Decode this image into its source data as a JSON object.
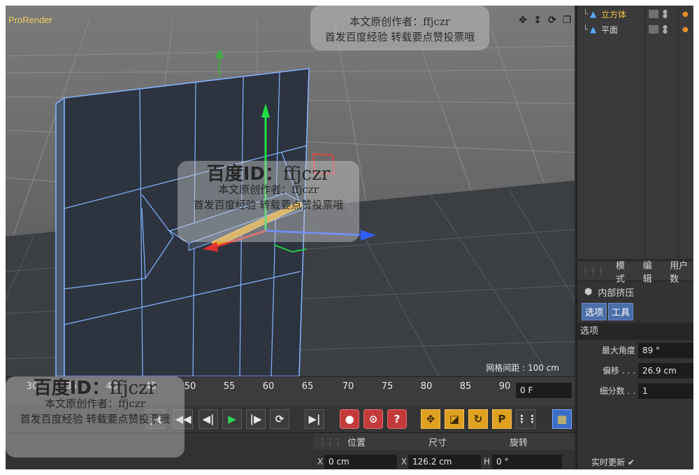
{
  "viewport": {
    "renderer_label": "ProRender",
    "grid_spacing": "网格间距 : 100 cm",
    "nav_icons": [
      "move-view-icon",
      "zoom-view-icon",
      "rotate-view-icon",
      "maximize-view-icon"
    ]
  },
  "objects": [
    {
      "name": "立方体",
      "icon": "cube-object-icon",
      "color": "#f0c040"
    },
    {
      "name": "平面",
      "icon": "plane-object-icon",
      "color": "#e0e0e0"
    }
  ],
  "attributes": {
    "menu": [
      "模式",
      "编辑",
      "用户数"
    ],
    "tool_name": "内部挤压",
    "tabs": [
      "选项",
      "工具"
    ],
    "section": "选项",
    "fields": [
      {
        "label": "最大角度",
        "value": "89 °"
      },
      {
        "label": "偏移 . . .",
        "value": "26.9 cm"
      },
      {
        "label": "细分数 . .",
        "value": "1"
      }
    ],
    "realtime_update": "实时更新 ✔"
  },
  "timeline": {
    "ticks": [
      "30",
      "35",
      "40",
      "45",
      "50",
      "55",
      "60",
      "65",
      "70",
      "75",
      "80",
      "85",
      "90"
    ],
    "current_frame": "0 F"
  },
  "transport": {
    "buttons": [
      {
        "name": "goto-start-button",
        "glyph": "|◀"
      },
      {
        "name": "prev-key-button",
        "glyph": "◀◀"
      },
      {
        "name": "prev-frame-button",
        "glyph": "◀|"
      },
      {
        "name": "play-button",
        "glyph": "▶"
      },
      {
        "name": "next-frame-button",
        "glyph": "|▶"
      },
      {
        "name": "loop-button",
        "glyph": "⟳"
      },
      {
        "name": "goto-end-button",
        "glyph": "▶|"
      }
    ],
    "key_buttons": [
      "●",
      "⊙",
      "?"
    ],
    "mode_buttons": [
      "✥",
      "◪",
      "↻",
      "P",
      "⋮⋮"
    ]
  },
  "coordinates": {
    "headers": [
      "位置",
      "尺寸",
      "旋转"
    ],
    "x_label": "X",
    "position_x": "0 cm",
    "size_x": "126.2 cm",
    "h_label": "H",
    "rotation_h": "0 °"
  },
  "watermark": {
    "id_prefix": "百度ID：",
    "id_value": "ffjczr",
    "line1": "本文原创作者：ffjczr",
    "line2": "首发百度经验  转载要点赞投票哦"
  }
}
